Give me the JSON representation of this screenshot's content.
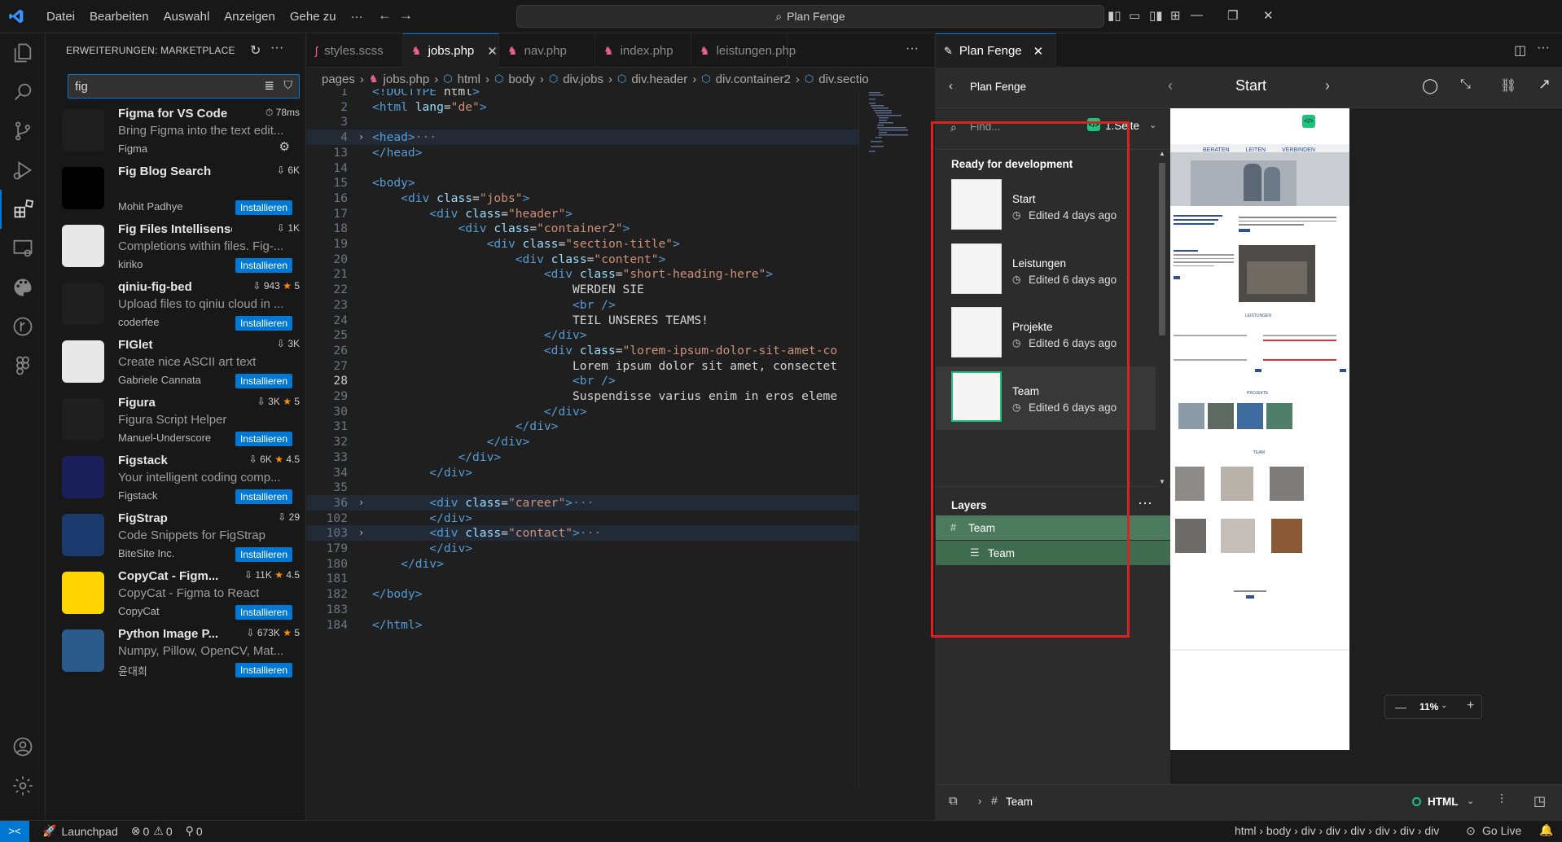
{
  "menu": [
    "Datei",
    "Bearbeiten",
    "Auswahl",
    "Anzeigen",
    "Gehe zu",
    "···"
  ],
  "command_center": "Plan Fenge",
  "sidebar": {
    "title": "ERWEITERUNGEN: MARKETPLACE",
    "search_value": "fig",
    "extensions": [
      {
        "name": "Figma for VS Code",
        "desc": "Bring Figma into the text edit...",
        "publisher": "Figma",
        "stat": "78ms",
        "stars": "",
        "action": "",
        "color": "#1e1e1e"
      },
      {
        "name": "Fig Blog Search",
        "desc": "",
        "publisher": "Mohit Padhye",
        "stat": "6K",
        "stars": "",
        "action": "Installieren",
        "color": "#000000"
      },
      {
        "name": "Fig Files Intellisense",
        "desc": "Completions within files. Fig-...",
        "publisher": "kiriko",
        "stat": "1K",
        "stars": "",
        "action": "Installieren",
        "color": "#e8e8e8"
      },
      {
        "name": "qiniu-fig-bed",
        "desc": "Upload files to qiniu cloud in ...",
        "publisher": "coderfee",
        "stat": "943",
        "stars": "5",
        "action": "Installieren",
        "color": "#1f1f1f"
      },
      {
        "name": "FIGlet",
        "desc": "Create nice ASCII art text",
        "publisher": "Gabriele Cannata",
        "stat": "3K",
        "stars": "",
        "action": "Installieren",
        "color": "#e8e8e8"
      },
      {
        "name": "Figura",
        "desc": "Figura Script Helper",
        "publisher": "Manuel-Underscore",
        "stat": "3K",
        "stars": "5",
        "action": "Installieren",
        "color": "#1f1f1f"
      },
      {
        "name": "Figstack",
        "desc": "Your intelligent coding comp...",
        "publisher": "Figstack",
        "stat": "6K",
        "stars": "4.5",
        "action": "Installieren",
        "color": "#1a1f5a"
      },
      {
        "name": "FigStrap",
        "desc": "Code Snippets for FigStrap",
        "publisher": "BiteSite Inc.",
        "stat": "29",
        "stars": "",
        "action": "Installieren",
        "color": "#1a3a6e"
      },
      {
        "name": "CopyCat - Figm...",
        "desc": "CopyCat - Figma to React",
        "publisher": "CopyCat",
        "stat": "11K",
        "stars": "4.5",
        "action": "Installieren",
        "color": "#ffd400"
      },
      {
        "name": "Python Image P...",
        "desc": "Numpy, Pillow, OpenCV, Mat...",
        "publisher": "윤대희",
        "stat": "673K",
        "stars": "5",
        "action": "Installieren",
        "color": "#2b5b8a"
      }
    ]
  },
  "tabs": [
    {
      "label": "styles.scss",
      "active": false,
      "close": ""
    },
    {
      "label": "jobs.php",
      "active": true,
      "close": "✕"
    },
    {
      "label": "nav.php",
      "active": false,
      "close": ""
    },
    {
      "label": "index.php",
      "active": false,
      "close": ""
    },
    {
      "label": "leistungen.php",
      "active": false,
      "close": ""
    }
  ],
  "breadcrumb": [
    "pages",
    "jobs.php",
    "html",
    "body",
    "div.jobs",
    "div.header",
    "div.container2",
    "div.sectio"
  ],
  "code_lines": [
    {
      "n": "1",
      "t": "<!DOCTYPE html>",
      "fold": false,
      "hl": false
    },
    {
      "n": "2",
      "t": "<html lang=\"de\">",
      "fold": false,
      "hl": false
    },
    {
      "n": "3",
      "t": "",
      "fold": false,
      "hl": false
    },
    {
      "n": "4",
      "t": "<head>···",
      "fold": true,
      "hl": true
    },
    {
      "n": "13",
      "t": "</head>",
      "fold": false,
      "hl": false
    },
    {
      "n": "14",
      "t": "",
      "fold": false,
      "hl": false
    },
    {
      "n": "15",
      "t": "<body>",
      "fold": false,
      "hl": false
    },
    {
      "n": "16",
      "t": "    <div class=\"jobs\">",
      "fold": false,
      "hl": false
    },
    {
      "n": "17",
      "t": "        <div class=\"header\">",
      "fold": false,
      "hl": false
    },
    {
      "n": "18",
      "t": "            <div class=\"container2\">",
      "fold": false,
      "hl": false
    },
    {
      "n": "19",
      "t": "                <div class=\"section-title\">",
      "fold": false,
      "hl": false
    },
    {
      "n": "20",
      "t": "                    <div class=\"content\">",
      "fold": false,
      "hl": false
    },
    {
      "n": "21",
      "t": "                        <div class=\"short-heading-here\">",
      "fold": false,
      "hl": false
    },
    {
      "n": "22",
      "t": "                            WERDEN SIE",
      "fold": false,
      "hl": false
    },
    {
      "n": "23",
      "t": "                            <br />",
      "fold": false,
      "hl": false
    },
    {
      "n": "24",
      "t": "                            TEIL UNSERES TEAMS!",
      "fold": false,
      "hl": false
    },
    {
      "n": "25",
      "t": "                        </div>",
      "fold": false,
      "hl": false
    },
    {
      "n": "26",
      "t": "                        <div class=\"lorem-ipsum-dolor-sit-amet-co",
      "fold": false,
      "hl": false
    },
    {
      "n": "27",
      "t": "                            Lorem ipsum dolor sit amet, consectet",
      "fold": false,
      "hl": false
    },
    {
      "n": "28",
      "t": "                            <br />",
      "fold": false,
      "hl": false
    },
    {
      "n": "29",
      "t": "                            Suspendisse varius enim in eros eleme",
      "fold": false,
      "hl": false
    },
    {
      "n": "30",
      "t": "                        </div>",
      "fold": false,
      "hl": false
    },
    {
      "n": "31",
      "t": "                    </div>",
      "fold": false,
      "hl": false
    },
    {
      "n": "32",
      "t": "                </div>",
      "fold": false,
      "hl": false
    },
    {
      "n": "33",
      "t": "            </div>",
      "fold": false,
      "hl": false
    },
    {
      "n": "34",
      "t": "        </div>",
      "fold": false,
      "hl": false
    },
    {
      "n": "35",
      "t": "",
      "fold": false,
      "hl": false
    },
    {
      "n": "36",
      "t": "        <div class=\"career\">···",
      "fold": true,
      "hl": true
    },
    {
      "n": "102",
      "t": "        </div>",
      "fold": false,
      "hl": false
    },
    {
      "n": "103",
      "t": "        <div class=\"contact\">···",
      "fold": true,
      "hl": true
    },
    {
      "n": "179",
      "t": "        </div>",
      "fold": false,
      "hl": false
    },
    {
      "n": "180",
      "t": "    </div>",
      "fold": false,
      "hl": false
    },
    {
      "n": "181",
      "t": "",
      "fold": false,
      "hl": false
    },
    {
      "n": "182",
      "t": "</body>",
      "fold": false,
      "hl": false
    },
    {
      "n": "183",
      "t": "",
      "fold": false,
      "hl": false
    },
    {
      "n": "184",
      "t": "</html>",
      "fold": false,
      "hl": false
    }
  ],
  "current_line": "28",
  "figma": {
    "tab_label": "Plan Fenge",
    "file_name": "Plan Fenge",
    "current_page": "Start",
    "find_placeholder": "Find...",
    "page_select": "1.Seite",
    "section_title": "Ready for development",
    "pages": [
      {
        "name": "Start",
        "edited": "Edited 4 days ago"
      },
      {
        "name": "Leistungen",
        "edited": "Edited 6 days ago"
      },
      {
        "name": "Projekte",
        "edited": "Edited 6 days ago"
      },
      {
        "name": "Team",
        "edited": "Edited 6 days ago"
      }
    ],
    "layers_title": "Layers",
    "layers": [
      {
        "name": "Team",
        "level": 0
      },
      {
        "name": "Team",
        "level": 1
      }
    ],
    "zoom": "11%",
    "bottom_layer": "Team",
    "lang": "HTML"
  },
  "canvas_text": {
    "nav": [
      "BERATEN",
      "LEITEN",
      "VERBINDEN"
    ],
    "leistungen": "LEISTUNGEN",
    "projekte": "PROJEKTE",
    "team": "TEAM"
  },
  "status": {
    "remote": "><",
    "launchpad": "Launchpad",
    "errors": "0",
    "warnings": "0",
    "ports": "0",
    "path": "html › body › div › div › div › div › div › div",
    "golive": "Go Live"
  }
}
